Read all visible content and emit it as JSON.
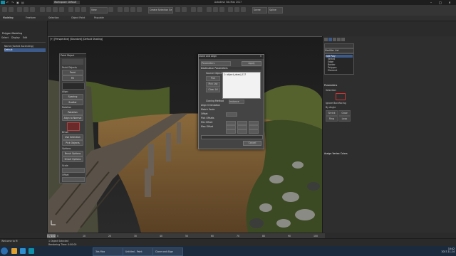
{
  "titlebar": {
    "workspace_tab": "Workspace: Default",
    "window_title": "Autodesk 3ds Max 2017",
    "controls": [
      "–",
      "□",
      "✕"
    ]
  },
  "toolbar": {
    "view_dropdown": "View",
    "selection_set": "Create Selection Se",
    "right_label1": "Scene",
    "right_label2": "Spline"
  },
  "ribbon": {
    "tabs": [
      "Modeling",
      "Freeform",
      "Selection",
      "Object Paint",
      "Populate"
    ]
  },
  "scene_explorer": {
    "header": "Polygon Modeling",
    "tabs": [
      "Select",
      "Display",
      "Edit"
    ],
    "items": [
      "Name (Sorted Ascending)",
      "Default"
    ]
  },
  "viewport": {
    "label": "[+] [Perspective] [Standard] [Default Shading]"
  },
  "tool_panel": {
    "title": "Paint Object",
    "buttons": [
      "Paint",
      "Fill",
      "Spacing",
      "Scatter",
      "Rotation",
      "Align to Normal",
      "Use Selection",
      "Pick Objects",
      "Brush Options",
      "Smart Options"
    ],
    "labels": [
      "Paint Objects",
      "Align:",
      "Rotation",
      "Brush",
      "Options",
      "Scale",
      "Offset"
    ]
  },
  "dialog": {
    "title": "Clone and Align",
    "source_label": "Source Objects",
    "dropdown": "Parameters",
    "buttons": [
      "Pick",
      "Pick List",
      "Clear All"
    ],
    "list_item": "1: object_dead_017",
    "section": "Destination Parameters",
    "fields": [
      "Cloning Method",
      "Align Orientation",
      "Match Scale",
      "Offset",
      "Pick Offsets",
      "Min Offset",
      "Max Offset"
    ],
    "clone_option": "Instance",
    "apply": "Apply",
    "cancel": "Cancel"
  },
  "command_panel": {
    "title": "Modifier List",
    "stack": [
      "Edit Poly",
      "Vertex",
      "Edge",
      "Border",
      "Polygon",
      "Element"
    ],
    "rollout_title": "Parameters",
    "rollout2": "Assign Vertex Colors",
    "options": [
      "Selection",
      "Ignore Backfacing",
      "By Angle",
      "Shrink",
      "Grow",
      "Ring",
      "Loop"
    ]
  },
  "timeline": {
    "frame": "0 / 100",
    "ticks": [
      "0",
      "10",
      "20",
      "30",
      "40",
      "50",
      "60",
      "70",
      "80",
      "90",
      "100"
    ]
  },
  "statusbar": {
    "message": "1 Object Selected",
    "prompt": "Rendering Time: 0:00:00",
    "welcome": "Welcome to M"
  },
  "taskbar": {
    "tasks": [
      "3ds Max",
      "Untitled - Paint",
      "Clone and Align"
    ],
    "clock": "10:42",
    "date": "2017-11-14"
  },
  "colors": {
    "accent": "#0f8fa8",
    "selection": "#3c5a8a",
    "taskbar": "#1b2a3d"
  }
}
